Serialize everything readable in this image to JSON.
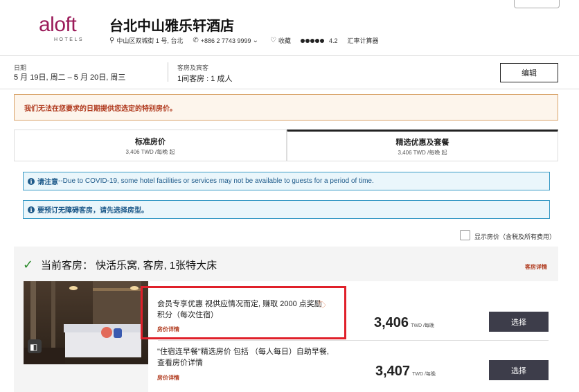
{
  "header": {
    "logo_text": "aloft",
    "logo_sub": "HOTELS",
    "hotel_name": "台北中山雅乐轩酒店",
    "address": "中山区双城街 1 号, 台北",
    "phone": "+886 2 7743 9999",
    "favorite": "收藏",
    "rating": "4.2",
    "currency": "汇率计算器",
    "rating_dots": 5
  },
  "search": {
    "date_label": "日期",
    "date_value": "5 月 19日, 周二 – 5 月 20日, 周三",
    "rooms_label": "客房及宾客",
    "rooms_value": "1间客房 : 1 成人",
    "edit_label": "编辑"
  },
  "warning": "我们无法在您要求的日期提供您选定的特别房价。",
  "tabs": [
    {
      "title": "标准房价",
      "sub": "3,406 TWD /每晚 起"
    },
    {
      "title": "精选优惠及套餐",
      "sub": "3,406 TWD /每晚 起"
    }
  ],
  "notices": {
    "covid_bold": "请注意",
    "covid_text": " --Due to COVID-19, some hotel facilities or services may not be available to guests for a period of time.",
    "accessible": "要预订无障碍客房，请先选择房型。"
  },
  "price_toggle_label": "显示房价（含税及所有费用）",
  "room": {
    "heading": "当前客房： 快活乐窝, 客房, 1张特大床",
    "details_link": "客房详情",
    "rates": [
      {
        "title": "会员专享优惠 视供应情况而定, 赚取 2000 点奖励积分（每次住宿）",
        "link": "房价详情",
        "price": "3,406",
        "unit": "TWD /每晚",
        "select": "选择"
      },
      {
        "title": "\"住宿连早餐\"精选房价 包括 （每人每日）自助早餐, 查看房价详情",
        "link": "房价详情",
        "price": "3,407",
        "unit": "TWD /每晚",
        "select": "选择"
      }
    ]
  },
  "colors": {
    "brand": "#9b1b5a",
    "warning_text": "#b03a1e",
    "info_border": "#3a9bc6",
    "select_button": "#3d3d4a",
    "highlight": "#e0202a"
  }
}
